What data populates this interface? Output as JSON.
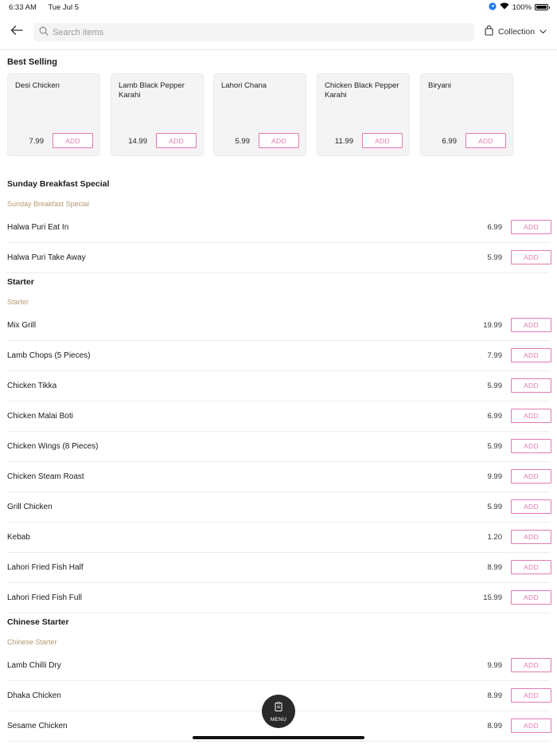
{
  "status_bar": {
    "time": "6:33 AM",
    "date": "Tue Jul 5",
    "battery": "100%"
  },
  "header": {
    "search_placeholder": "Search items",
    "collection_label": "Collection"
  },
  "best_selling": {
    "title": "Best Selling",
    "items": [
      {
        "name": "Desi Chicken",
        "price": "7.99",
        "add_label": "ADD"
      },
      {
        "name": "Lamb Black Pepper Karahi",
        "price": "14.99",
        "add_label": "ADD"
      },
      {
        "name": "Lahori Chana",
        "price": "5.99",
        "add_label": "ADD"
      },
      {
        "name": "Chicken Black Pepper Karahi",
        "price": "11.99",
        "add_label": "ADD"
      },
      {
        "name": "Biryani",
        "price": "6.99",
        "add_label": "ADD"
      }
    ]
  },
  "sections": [
    {
      "title": "Sunday Breakfast Special",
      "subtitle": "Sunday Breakfast Special",
      "items": [
        {
          "name": "Halwa Puri Eat In",
          "price": "6.99",
          "add_label": "ADD"
        },
        {
          "name": "Halwa Puri Take Away",
          "price": "5.99",
          "add_label": "ADD"
        }
      ]
    },
    {
      "title": "Starter",
      "subtitle": "Starter",
      "items": [
        {
          "name": "Mix Grill",
          "price": "19.99",
          "add_label": "ADD"
        },
        {
          "name": "Lamb Chops (5 Pieces)",
          "price": "7.99",
          "add_label": "ADD"
        },
        {
          "name": "Chicken Tikka",
          "price": "5.99",
          "add_label": "ADD"
        },
        {
          "name": "Chicken Malai Boti",
          "price": "6.99",
          "add_label": "ADD"
        },
        {
          "name": "Chicken Wings (8 Pieces)",
          "price": "5.99",
          "add_label": "ADD"
        },
        {
          "name": "Chicken Steam Roast",
          "price": "9.99",
          "add_label": "ADD"
        },
        {
          "name": "Grill Chicken",
          "price": "5.99",
          "add_label": "ADD"
        },
        {
          "name": "Kebab",
          "price": "1.20",
          "add_label": "ADD"
        },
        {
          "name": "Lahori Fried Fish Half",
          "price": "8.99",
          "add_label": "ADD"
        },
        {
          "name": "Lahori Fried Fish Full",
          "price": "15.99",
          "add_label": "ADD"
        }
      ]
    },
    {
      "title": "Chinese Starter",
      "subtitle": "Chinese Starter",
      "items": [
        {
          "name": "Lamb Chilli Dry",
          "price": "9.99",
          "add_label": "ADD"
        },
        {
          "name": "Dhaka Chicken",
          "price": "8.99",
          "add_label": "ADD"
        },
        {
          "name": "Sesame Chicken",
          "price": "8.99",
          "add_label": "ADD"
        }
      ]
    }
  ],
  "menu_button": {
    "label": "MENU"
  },
  "colors": {
    "accent": "#e27bb2",
    "subtitle": "#b39a72"
  },
  "icons": {
    "back": "arrow-left-icon",
    "search": "search-icon",
    "bag": "shopping-bag-icon",
    "chevron": "chevron-down-icon",
    "menu": "clipboard-icon"
  }
}
